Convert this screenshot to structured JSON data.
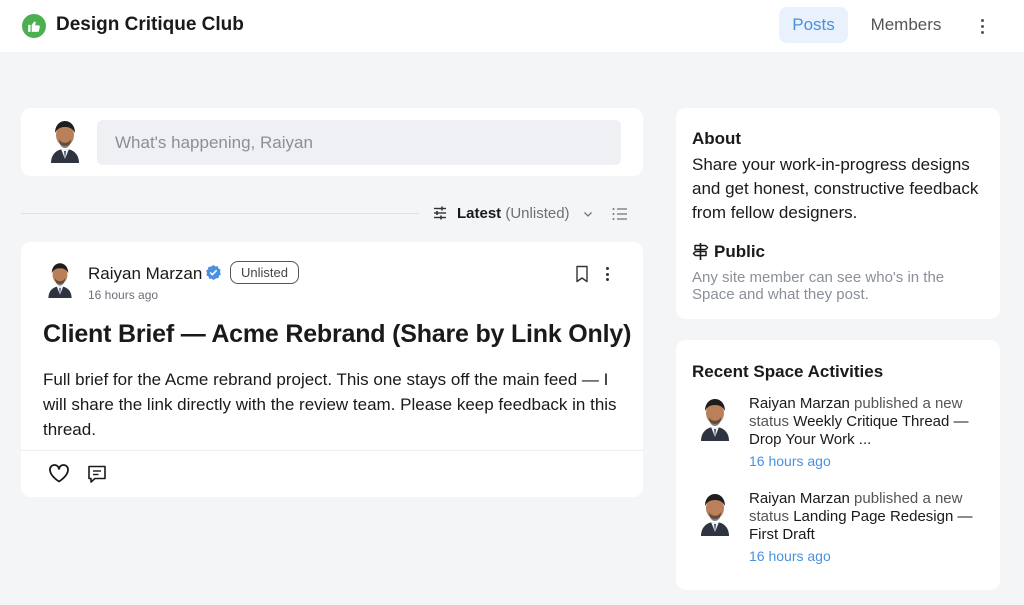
{
  "header": {
    "space_title": "Design Critique Club",
    "tabs": [
      {
        "label": "Posts",
        "active": true
      },
      {
        "label": "Members",
        "active": false
      }
    ],
    "logo_icon": "thumbs-up-icon",
    "accent_color": "#4a90e2",
    "logo_color": "#4caf50"
  },
  "composer": {
    "placeholder": "What's happening, Raiyan"
  },
  "sort": {
    "label": "Latest",
    "qualifier": "(Unlisted)"
  },
  "post": {
    "author": "Raiyan Marzan",
    "badge": "Unlisted",
    "time": "16 hours ago",
    "title": "Client Brief — Acme Rebrand (Share by Link Only)",
    "body": "Full brief for the Acme rebrand project. This one stays off the main feed — I will share the link directly with the review team. Please keep feedback in this thread."
  },
  "about": {
    "title": "About",
    "description": "Share your work-in-progress designs and get honest, constructive feedback from fellow designers.",
    "visibility_label": "Public",
    "visibility_desc": "Any site member can see who's in the Space and what they post."
  },
  "activities": {
    "title": "Recent Space Activities",
    "items": [
      {
        "actor": "Raiyan Marzan",
        "action": " published a new status ",
        "subject": "Weekly Critique Thread — Drop Your Work ...",
        "time": "16 hours ago"
      },
      {
        "actor": "Raiyan Marzan",
        "action": " published a new status ",
        "subject": "Landing Page Redesign — First Draft",
        "time": "16 hours ago"
      }
    ]
  }
}
